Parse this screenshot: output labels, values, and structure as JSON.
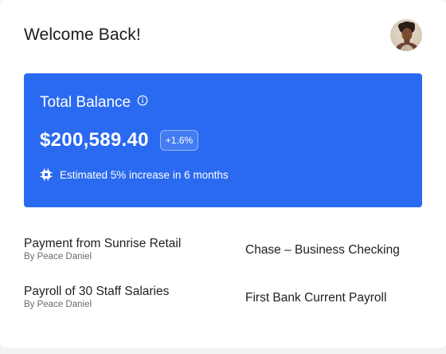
{
  "header": {
    "title": "Welcome Back!",
    "avatar_icon": "user-avatar-photo"
  },
  "balance_card": {
    "label": "Total Balance",
    "info_icon": "info-icon",
    "amount": "$200,589.40",
    "change": "+1.6%",
    "estimate_icon": "chip-icon",
    "estimate_text": "Estimated 5% increase in 6 months",
    "background_color": "#2a6af0"
  },
  "transactions": [
    {
      "title": "Payment from Sunrise Retail",
      "by": "By Peace Daniel",
      "account": "Chase – Business Checking"
    },
    {
      "title": "Payroll of 30 Staff Salaries",
      "by": "By Peace Daniel",
      "account": "First Bank Current Payroll"
    }
  ]
}
